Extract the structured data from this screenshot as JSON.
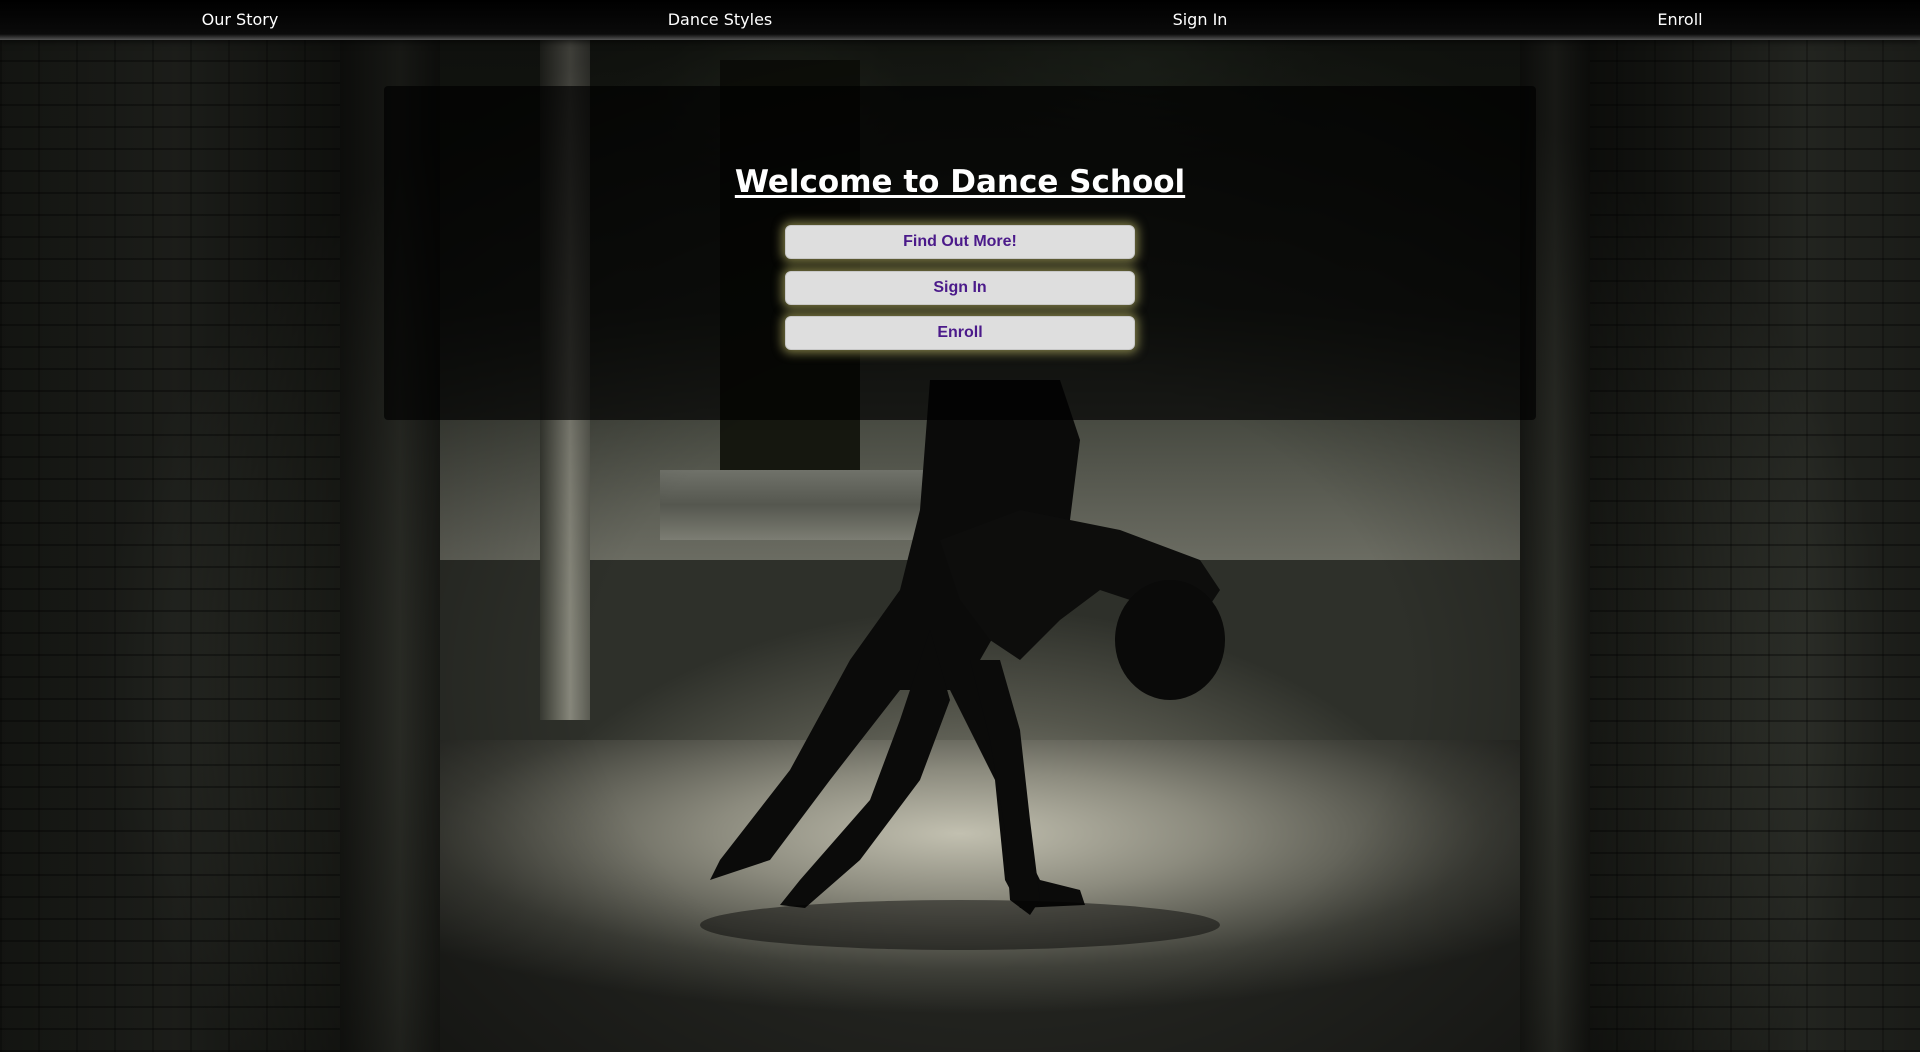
{
  "nav": {
    "items": [
      {
        "label": "Our Story"
      },
      {
        "label": "Dance Styles"
      },
      {
        "label": "Sign In"
      },
      {
        "label": "Enroll"
      }
    ]
  },
  "hero": {
    "title": "Welcome to Dance School",
    "buttons": {
      "find_out_more": "Find Out More!",
      "sign_in": "Sign In",
      "enroll": "Enroll"
    }
  },
  "colors": {
    "nav_background": "#000000",
    "button_background": "#dedede",
    "button_text": "#4b1a8a",
    "button_glow": "#dcd778"
  }
}
